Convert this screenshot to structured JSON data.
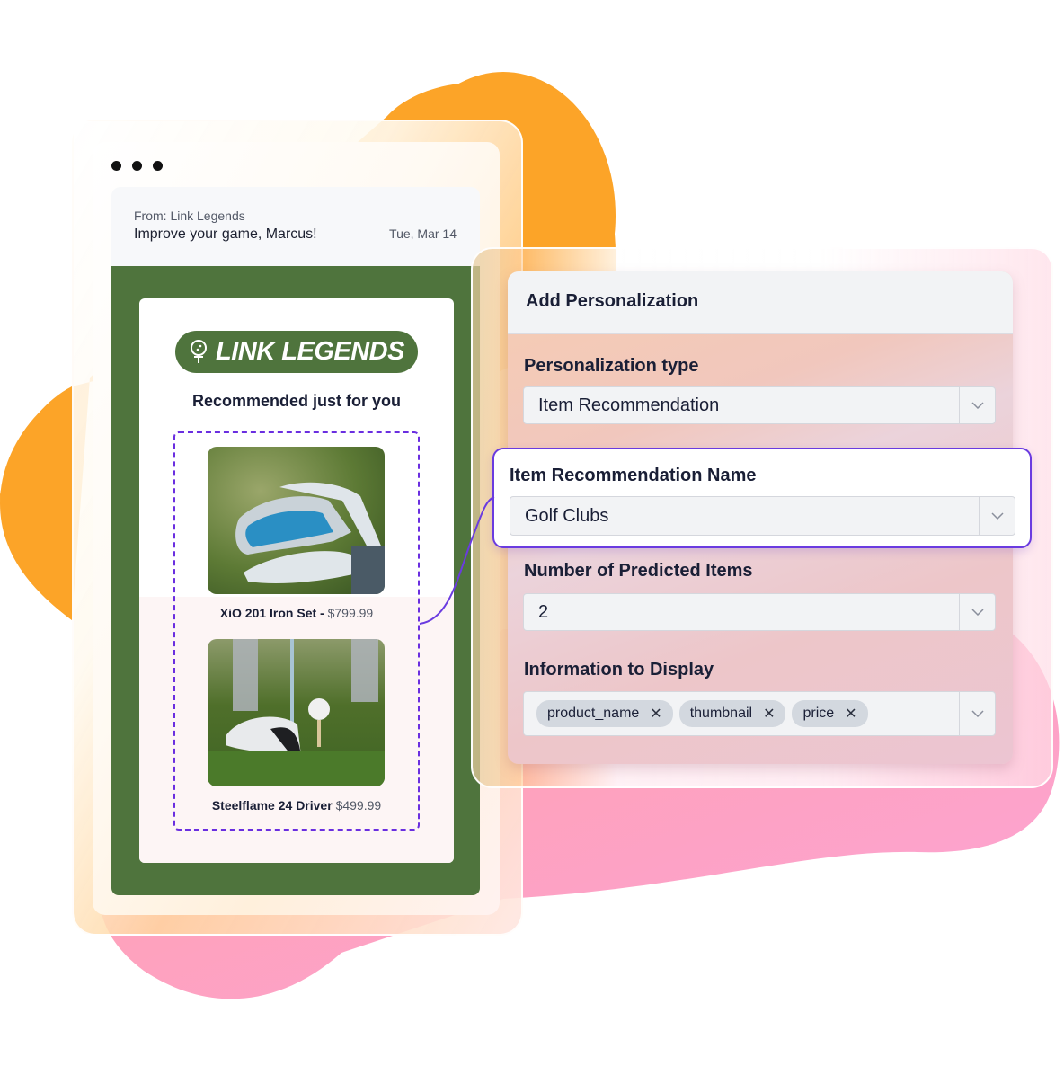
{
  "colors": {
    "brand_green": "#4f743d",
    "accent_purple": "#6a3be0",
    "blob_orange": "#fca428",
    "blob_pink": "#fca4c0"
  },
  "window_controls": {
    "icon": "more-dots-icon"
  },
  "email": {
    "from": "From: Link Legends",
    "subject": "Improve your game, Marcus!",
    "date": "Tue, Mar 14",
    "logo_icon": "golf-ball-on-tee-icon",
    "logo_text": "LINK LEGENDS",
    "recommendation_heading": "Recommended just for you",
    "products": [
      {
        "name": "XiO 201 Iron Set -",
        "price": "$799.99",
        "image": "golf-irons-image"
      },
      {
        "name": "Steelflame 24 Driver",
        "price": "$499.99",
        "image": "golf-driver-and-ball-image"
      }
    ]
  },
  "panel": {
    "title": "Add Personalization",
    "fields": {
      "personalization_type": {
        "label": "Personalization type",
        "value": "Item Recommendation"
      },
      "item_recommendation_name": {
        "label": "Item Recommendation Name",
        "value": "Golf Clubs"
      },
      "number_of_predicted_items": {
        "label": "Number of Predicted Items",
        "value": "2"
      },
      "information_to_display": {
        "label": "Information to Display",
        "tags": [
          "product_name",
          "thumbnail",
          "price"
        ],
        "remove_glyph": "✕"
      }
    },
    "chevron_glyph": "⌄"
  }
}
